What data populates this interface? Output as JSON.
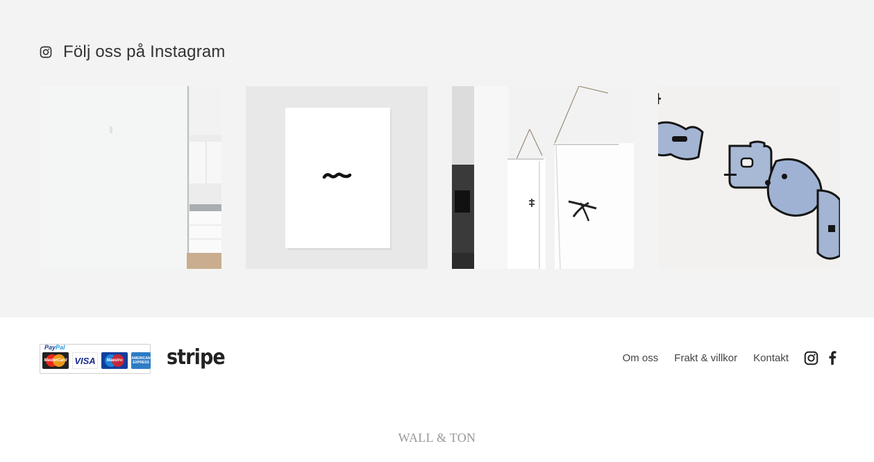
{
  "instagram": {
    "heading": "Följ oss på Instagram",
    "icon": "instagram-icon",
    "posts": [
      {
        "subject": "white wall with kitchen doorway"
      },
      {
        "subject": "white poster with black squiggle on grey wall"
      },
      {
        "subject": "hanging posters with black symbols"
      },
      {
        "subject": "blue and black illustrated robot print close-up"
      }
    ]
  },
  "footer": {
    "payment": {
      "paypal_label_pay": "Pay",
      "paypal_label_pal": "Pal",
      "cards": {
        "mastercard": "MasterCard",
        "visa": "VISA",
        "maestro": "Maestro",
        "amex_top": "AMERICAN",
        "amex_bottom": "EXPRESS"
      },
      "stripe": "stripe"
    },
    "nav": {
      "about": "Om oss",
      "shipping": "Frakt & villkor",
      "contact": "Kontakt"
    },
    "social": [
      "instagram-icon",
      "facebook-icon"
    ],
    "brand": "WALL & TON"
  },
  "colors": {
    "section_bg": "#f3f3f3",
    "text": "#333333",
    "brand": "#999999"
  }
}
